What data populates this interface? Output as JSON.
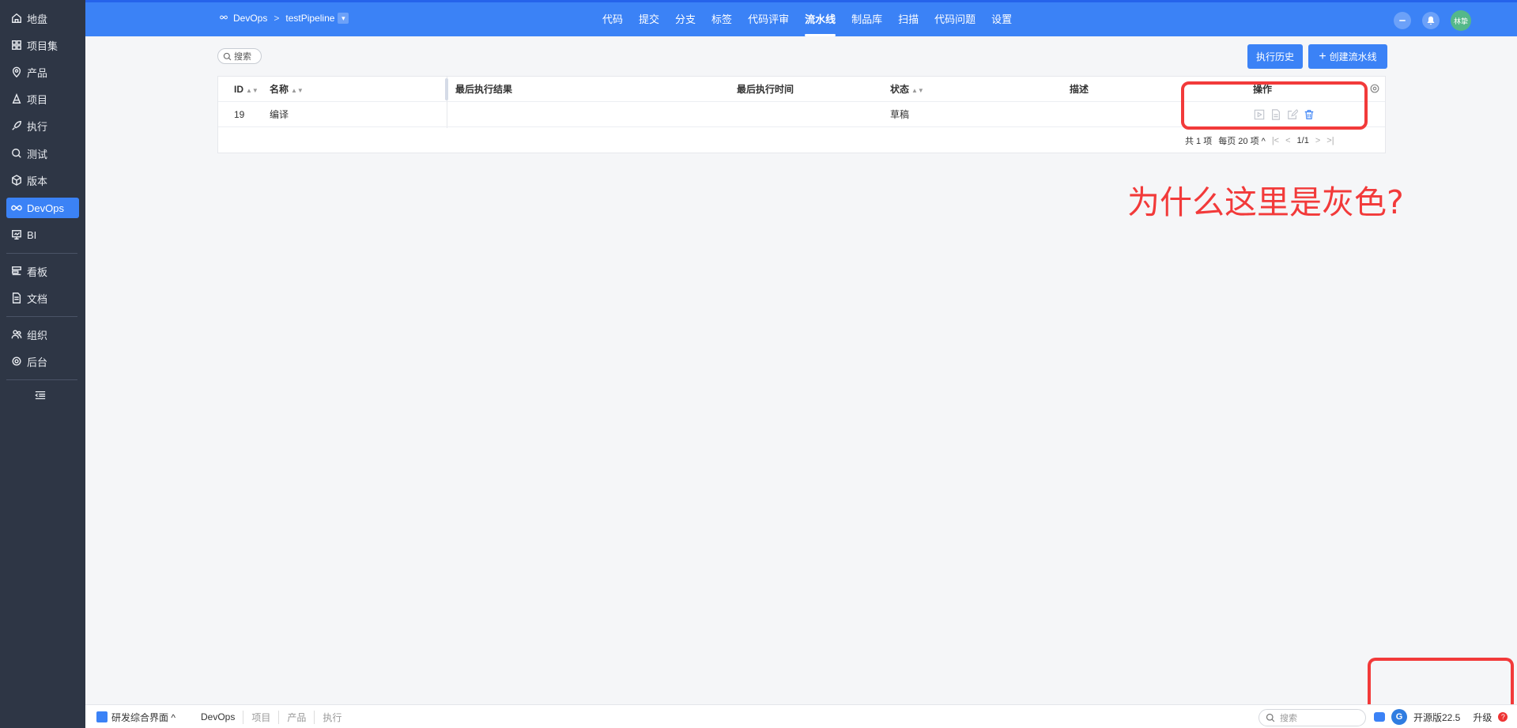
{
  "sidebar": {
    "items": [
      {
        "label": "地盘",
        "icon": "home-icon"
      },
      {
        "label": "项目集",
        "icon": "grid-icon"
      },
      {
        "label": "产品",
        "icon": "location-pin-icon"
      },
      {
        "label": "项目",
        "icon": "project-icon"
      },
      {
        "label": "执行",
        "icon": "rocket-icon"
      },
      {
        "label": "测试",
        "icon": "magnifier-icon"
      },
      {
        "label": "版本",
        "icon": "cube-icon"
      },
      {
        "label": "DevOps",
        "icon": "infinity-icon",
        "active": true
      },
      {
        "label": "BI",
        "icon": "presentation-icon"
      },
      {
        "label": "看板",
        "icon": "kanban-icon"
      },
      {
        "label": "文档",
        "icon": "document-icon"
      },
      {
        "label": "组织",
        "icon": "people-icon"
      },
      {
        "label": "后台",
        "icon": "gear-icon"
      }
    ]
  },
  "header": {
    "breadcrumb": {
      "root": "DevOps",
      "separator": ">",
      "repo": "testPipeline"
    },
    "tabs": [
      {
        "label": "代码"
      },
      {
        "label": "提交"
      },
      {
        "label": "分支"
      },
      {
        "label": "标签"
      },
      {
        "label": "代码评审"
      },
      {
        "label": "流水线",
        "active": true
      },
      {
        "label": "制品库"
      },
      {
        "label": "扫描"
      },
      {
        "label": "代码问题"
      },
      {
        "label": "设置"
      }
    ],
    "user_avatar_text": "林挚",
    "accent_color": "#3b82f6"
  },
  "toolbar": {
    "search_label": "搜索",
    "history_button": "执行历史",
    "create_button": "创建流水线"
  },
  "table": {
    "columns": [
      "ID",
      "名称",
      "最后执行结果",
      "最后执行时间",
      "状态",
      "描述",
      "操作"
    ],
    "rows": [
      {
        "id": "19",
        "name": "编译",
        "last_result": "",
        "last_time": "",
        "status": "草稿",
        "description": ""
      }
    ],
    "actions": [
      "run-icon",
      "log-icon",
      "edit-icon",
      "delete-icon"
    ]
  },
  "pagination": {
    "total": "共 1 项",
    "per_page": "每页 20 项",
    "page": "1/1"
  },
  "annotation": {
    "text": "为什么这里是灰色?",
    "color": "#f23a3a"
  },
  "footer": {
    "app_label": "研发综合界面",
    "crumbs": [
      "DevOps",
      "项目",
      "产品",
      "执行"
    ],
    "search_placeholder": "搜索",
    "version": "开源版22.5",
    "upgrade": "升级"
  }
}
